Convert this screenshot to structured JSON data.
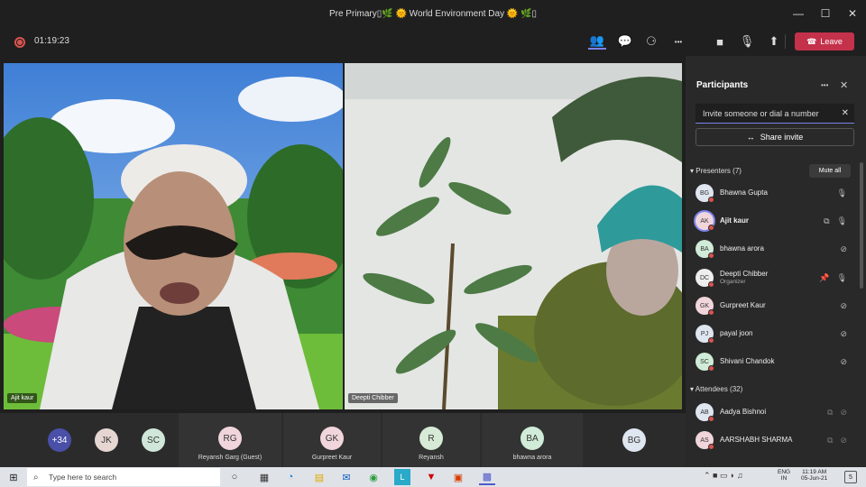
{
  "window": {
    "title": "Pre Primary▯🌿 🌞 World Environment Day 🌞 🌿▯",
    "minimize": "—",
    "maximize": "☐",
    "close": "✕"
  },
  "toolbar": {
    "timer": "01:19:23",
    "leave_label": "Leave",
    "icons": {
      "people": "👥",
      "chat": "💬",
      "reactions": "⚆",
      "more": "•••",
      "camera": "■",
      "mic": "🎙",
      "share": "⬆",
      "phone": "☎"
    }
  },
  "videos": [
    {
      "name": "Ajit kaur"
    },
    {
      "name": "Deepti Chibber"
    }
  ],
  "tiles": [
    {
      "initials": "+34",
      "name": ""
    },
    {
      "initials": "JK",
      "name": ""
    },
    {
      "initials": "SC",
      "name": ""
    },
    {
      "initials": "RG",
      "name": "Reyansh Garg (Guest)"
    },
    {
      "initials": "GK",
      "name": "Gurpreet Kaur"
    },
    {
      "initials": "R",
      "name": "Reyansh"
    },
    {
      "initials": "BA",
      "name": "bhawna arora"
    },
    {
      "initials": "BG",
      "name": ""
    }
  ],
  "panel": {
    "title": "Participants",
    "more": "•••",
    "close": "✕",
    "invite_placeholder": "Invite someone or dial a number",
    "share_invite": "Share invite",
    "presenters_label": "Presenters (7)",
    "mute_all": "Mute all",
    "presenters": [
      {
        "initials": "BG",
        "name": "Bhawna Gupta",
        "role": ""
      },
      {
        "initials": "AK",
        "name": "Ajit kaur",
        "role": ""
      },
      {
        "initials": "BA",
        "name": "bhawna arora",
        "role": ""
      },
      {
        "initials": "DC",
        "name": "Deepti Chibber",
        "role": "Organizer"
      },
      {
        "initials": "GK",
        "name": "Gurpreet Kaur",
        "role": ""
      },
      {
        "initials": "PJ",
        "name": "payal joon",
        "role": ""
      },
      {
        "initials": "SC",
        "name": "Shivani Chandok",
        "role": ""
      }
    ],
    "attendees_label": "Attendees (32)",
    "attendees": [
      {
        "initials": "AB",
        "name": "Aadya Bishnoi"
      },
      {
        "initials": "AS",
        "name": "AARSHABH SHARMA"
      }
    ]
  },
  "taskbar": {
    "search_placeholder": "Type here to search",
    "lang_top": "ENG",
    "lang_bottom": "IN",
    "time": "11:19 AM",
    "date": "05-Jun-21",
    "notif_count": "5"
  }
}
